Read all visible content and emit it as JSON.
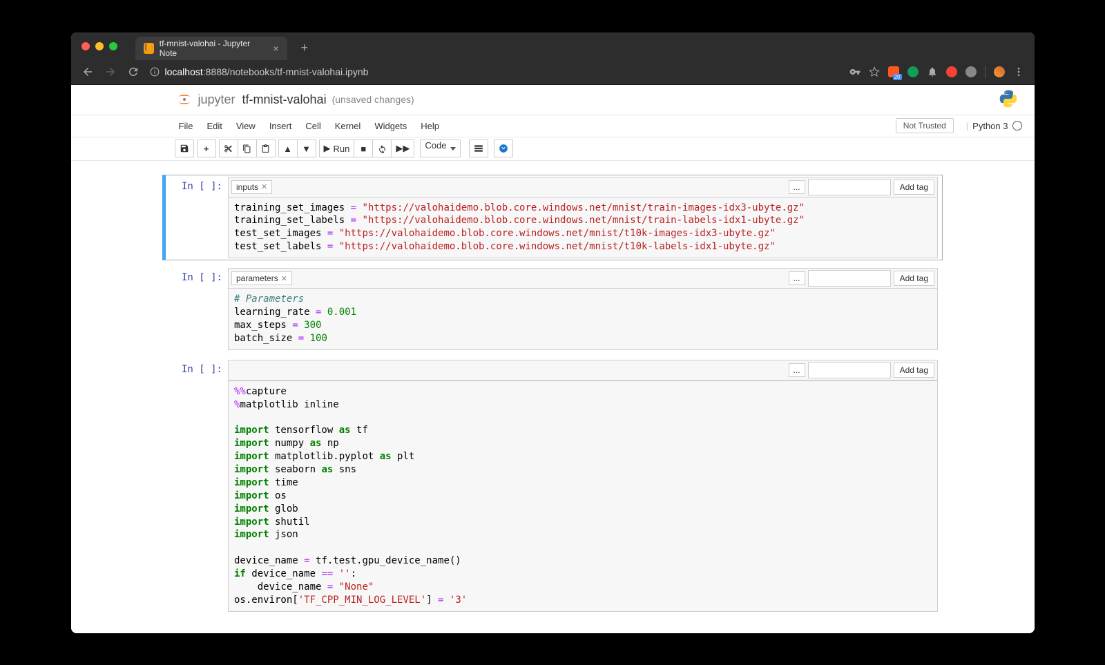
{
  "browser": {
    "tab_title": "tf-mnist-valohai - Jupyter Note",
    "url_prefix": "localhost",
    "url_rest": ":8888/notebooks/tf-mnist-valohai.ipynb",
    "ext_badge": "20"
  },
  "header": {
    "logo_text": "jupyter",
    "title": "tf-mnist-valohai",
    "status": "(unsaved changes)"
  },
  "menu": {
    "items": [
      "File",
      "Edit",
      "View",
      "Insert",
      "Cell",
      "Kernel",
      "Widgets",
      "Help"
    ],
    "trust": "Not Trusted",
    "kernel": "Python 3"
  },
  "toolbar": {
    "run_label": "Run",
    "dropdown": "Code"
  },
  "cells": [
    {
      "prompt": "In [ ]:",
      "tag": "inputs",
      "add_tag": "Add tag",
      "dots": "...",
      "code_tokens": [
        [
          [
            "v",
            "training_set_images"
          ],
          [
            "o",
            " = "
          ],
          [
            "s",
            "\"https://valohaidemo.blob.core.windows.net/mnist/train-images-idx3-ubyte.gz\""
          ]
        ],
        [
          [
            "v",
            "training_set_labels"
          ],
          [
            "o",
            " = "
          ],
          [
            "s",
            "\"https://valohaidemo.blob.core.windows.net/mnist/train-labels-idx1-ubyte.gz\""
          ]
        ],
        [
          [
            "v",
            "test_set_images"
          ],
          [
            "o",
            " = "
          ],
          [
            "s",
            "\"https://valohaidemo.blob.core.windows.net/mnist/t10k-images-idx3-ubyte.gz\""
          ]
        ],
        [
          [
            "v",
            "test_set_labels"
          ],
          [
            "o",
            " = "
          ],
          [
            "s",
            "\"https://valohaidemo.blob.core.windows.net/mnist/t10k-labels-idx1-ubyte.gz\""
          ]
        ]
      ]
    },
    {
      "prompt": "In [ ]:",
      "tag": "parameters",
      "add_tag": "Add tag",
      "dots": "...",
      "code_tokens": [
        [
          [
            "c",
            "# Parameters"
          ]
        ],
        [
          [
            "v",
            "learning_rate"
          ],
          [
            "o",
            " = "
          ],
          [
            "n",
            "0.001"
          ]
        ],
        [
          [
            "v",
            "max_steps"
          ],
          [
            "o",
            " = "
          ],
          [
            "n",
            "300"
          ]
        ],
        [
          [
            "v",
            "batch_size"
          ],
          [
            "o",
            " = "
          ],
          [
            "n",
            "100"
          ]
        ]
      ]
    },
    {
      "prompt": "In [ ]:",
      "add_tag": "Add tag",
      "dots": "...",
      "code_tokens": [
        [
          [
            "o",
            "%%"
          ],
          [
            "v",
            "capture"
          ]
        ],
        [
          [
            "o",
            "%"
          ],
          [
            "v",
            "matplotlib inline"
          ]
        ],
        [
          [
            "v",
            ""
          ]
        ],
        [
          [
            "k",
            "import"
          ],
          [
            "v",
            " tensorflow "
          ],
          [
            "k",
            "as"
          ],
          [
            "v",
            " tf"
          ]
        ],
        [
          [
            "k",
            "import"
          ],
          [
            "v",
            " numpy "
          ],
          [
            "k",
            "as"
          ],
          [
            "v",
            " np"
          ]
        ],
        [
          [
            "k",
            "import"
          ],
          [
            "v",
            " matplotlib.pyplot "
          ],
          [
            "k",
            "as"
          ],
          [
            "v",
            " plt"
          ]
        ],
        [
          [
            "k",
            "import"
          ],
          [
            "v",
            " seaborn "
          ],
          [
            "k",
            "as"
          ],
          [
            "v",
            " sns"
          ]
        ],
        [
          [
            "k",
            "import"
          ],
          [
            "v",
            " time"
          ]
        ],
        [
          [
            "k",
            "import"
          ],
          [
            "v",
            " os"
          ]
        ],
        [
          [
            "k",
            "import"
          ],
          [
            "v",
            " glob"
          ]
        ],
        [
          [
            "k",
            "import"
          ],
          [
            "v",
            " shutil"
          ]
        ],
        [
          [
            "k",
            "import"
          ],
          [
            "v",
            " json"
          ]
        ],
        [
          [
            "v",
            ""
          ]
        ],
        [
          [
            "v",
            "device_name"
          ],
          [
            "o",
            " = "
          ],
          [
            "v",
            "tf.test.gpu_device_name()"
          ]
        ],
        [
          [
            "k",
            "if"
          ],
          [
            "v",
            " device_name"
          ],
          [
            "o",
            " == "
          ],
          [
            "s",
            "''"
          ],
          [
            "v",
            ":"
          ]
        ],
        [
          [
            "v",
            "    device_name"
          ],
          [
            "o",
            " = "
          ],
          [
            "s",
            "\"None\""
          ]
        ],
        [
          [
            "v",
            "os.environ["
          ],
          [
            "s",
            "'TF_CPP_MIN_LOG_LEVEL'"
          ],
          [
            "v",
            "]"
          ],
          [
            "o",
            " = "
          ],
          [
            "s",
            "'3'"
          ]
        ]
      ]
    }
  ]
}
